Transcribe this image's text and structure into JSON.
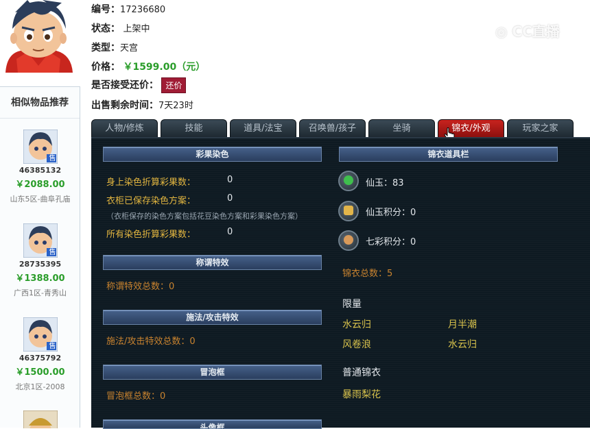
{
  "item": {
    "id_label": "编号：",
    "id_value": "17236680",
    "status_label": "状态：",
    "status_value": "上架中",
    "type_label": "类型：",
    "type_value": "天宫",
    "price_label": "价格：",
    "price_value": "￥1599.00（元）",
    "haggle_label": "是否接受还价：",
    "haggle_button": "还价",
    "time_label": "出售剩余时间：",
    "time_value": "7天23时"
  },
  "watermark": "CC直播",
  "sidebar": {
    "title": "相似物品推荐",
    "items": [
      {
        "id": "46385132",
        "price": "￥2088.00",
        "server": "山东5区-曲阜孔庙",
        "badge": "售"
      },
      {
        "id": "28735395",
        "price": "￥1388.00",
        "server": "广西1区-青秀山",
        "badge": "售"
      },
      {
        "id": "46375792",
        "price": "￥1500.00",
        "server": "北京1区-2008",
        "badge": "售"
      }
    ]
  },
  "tabs": [
    {
      "label": "人物/修炼",
      "active": false
    },
    {
      "label": "技能",
      "active": false
    },
    {
      "label": "道具/法宝",
      "active": false
    },
    {
      "label": "召唤兽/孩子",
      "active": false
    },
    {
      "label": "坐骑",
      "active": false
    },
    {
      "label": "锦衣/外观",
      "active": true
    },
    {
      "label": "玩家之家",
      "active": false
    }
  ],
  "left_sections": {
    "dye": {
      "title": "彩果染色",
      "body_total_label": "身上染色折算彩果数：",
      "body_total_value": "0",
      "wardrobe_label": "衣柜已保存染色方案：",
      "wardrobe_value": "0",
      "note": "（衣柜保存的染色方案包括花豆染色方案和彩果染色方案）",
      "all_total_label": "所有染色折算彩果数：",
      "all_total_value": "0"
    },
    "title_effect": {
      "title": "称谓特效",
      "count_label": "称谓特效总数：0"
    },
    "cast_effect": {
      "title": "施法/攻击特效",
      "count_label": "施法/攻击特效总数：0"
    },
    "bubble": {
      "title": "冒泡框",
      "count_label": "冒泡框总数：0"
    },
    "avatar_frame": {
      "title": "头像框"
    }
  },
  "right_sections": {
    "title": "锦衣道具栏",
    "props": [
      {
        "label": "仙玉：83",
        "icon": "jade-icon"
      },
      {
        "label": "仙玉积分：0",
        "icon": "jade-points-icon"
      },
      {
        "label": "七彩积分：0",
        "icon": "rainbow-points-icon"
      }
    ],
    "total_label": "锦衣总数：5",
    "limited_title": "限量",
    "limited_items": [
      "水云归",
      "月半潮",
      "风卷浪",
      "水云归"
    ],
    "normal_title": "普通锦衣",
    "normal_items": [
      "暴雨梨花"
    ]
  },
  "colors": {
    "accent_red": "#a01c35",
    "price_green": "#2a9d2a",
    "panel_bg": "#0e1a22",
    "gold_label": "#e3b640"
  }
}
